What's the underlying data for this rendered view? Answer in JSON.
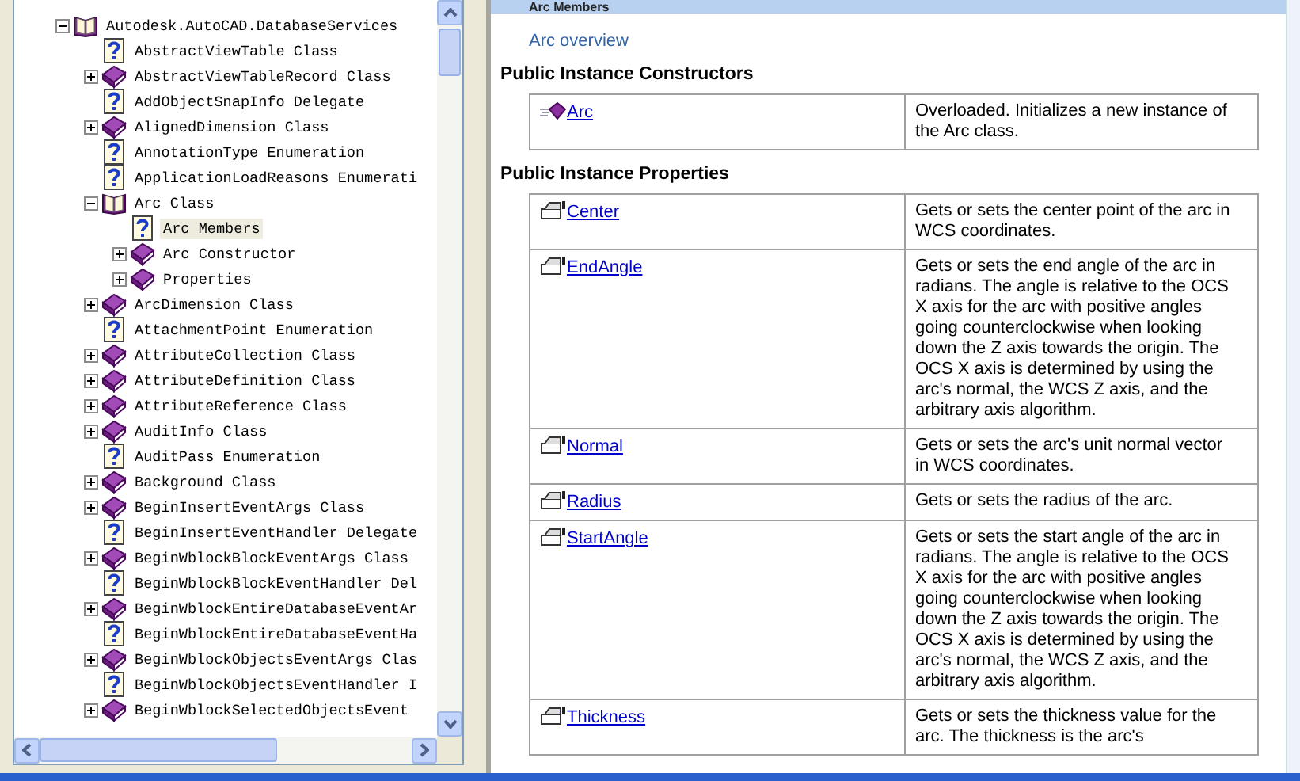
{
  "tree": [
    {
      "label": "Autodesk.AutoCAD.DatabaseServices",
      "kind": "namespace",
      "expanded": true,
      "selected": false,
      "children": [
        {
          "label": "AbstractViewTable Class",
          "kind": "page",
          "selected": false
        },
        {
          "label": "AbstractViewTableRecord Class",
          "kind": "class",
          "expanded": false,
          "selected": false
        },
        {
          "label": "AddObjectSnapInfo Delegate",
          "kind": "page",
          "selected": false
        },
        {
          "label": "AlignedDimension Class",
          "kind": "class",
          "expanded": false,
          "selected": false
        },
        {
          "label": "AnnotationType Enumeration",
          "kind": "page",
          "selected": false
        },
        {
          "label": "ApplicationLoadReasons Enumerati",
          "kind": "page",
          "selected": false
        },
        {
          "label": "Arc Class",
          "kind": "class",
          "expanded": true,
          "selected": false,
          "children": [
            {
              "label": "Arc Members",
              "kind": "page",
              "selected": true
            },
            {
              "label": "Arc Constructor",
              "kind": "class",
              "expanded": false,
              "selected": false
            },
            {
              "label": "Properties",
              "kind": "class",
              "expanded": false,
              "selected": false
            }
          ]
        },
        {
          "label": "ArcDimension Class",
          "kind": "class",
          "expanded": false,
          "selected": false
        },
        {
          "label": "AttachmentPoint Enumeration",
          "kind": "page",
          "selected": false
        },
        {
          "label": "AttributeCollection Class",
          "kind": "class",
          "expanded": false,
          "selected": false
        },
        {
          "label": "AttributeDefinition Class",
          "kind": "class",
          "expanded": false,
          "selected": false
        },
        {
          "label": "AttributeReference Class",
          "kind": "class",
          "expanded": false,
          "selected": false
        },
        {
          "label": "AuditInfo Class",
          "kind": "class",
          "expanded": false,
          "selected": false
        },
        {
          "label": "AuditPass Enumeration",
          "kind": "page",
          "selected": false
        },
        {
          "label": "Background Class",
          "kind": "class",
          "expanded": false,
          "selected": false
        },
        {
          "label": "BeginInsertEventArgs Class",
          "kind": "class",
          "expanded": false,
          "selected": false
        },
        {
          "label": "BeginInsertEventHandler Delegate",
          "kind": "page",
          "selected": false
        },
        {
          "label": "BeginWblockBlockEventArgs Class",
          "kind": "class",
          "expanded": false,
          "selected": false
        },
        {
          "label": "BeginWblockBlockEventHandler Del",
          "kind": "page",
          "selected": false
        },
        {
          "label": "BeginWblockEntireDatabaseEventAr",
          "kind": "class",
          "expanded": false,
          "selected": false
        },
        {
          "label": "BeginWblockEntireDatabaseEventHa",
          "kind": "page",
          "selected": false
        },
        {
          "label": "BeginWblockObjectsEventArgs Clas",
          "kind": "class",
          "expanded": false,
          "selected": false
        },
        {
          "label": "BeginWblockObjectsEventHandler I",
          "kind": "page",
          "selected": false
        },
        {
          "label": "BeginWblockSelectedObjectsEvent",
          "kind": "class",
          "expanded": false,
          "selected": false
        }
      ]
    }
  ],
  "page": {
    "title": "Arc Members",
    "overview_link": "Arc overview",
    "sections": [
      {
        "heading": "Public Instance Constructors",
        "rows": [
          {
            "kind": "method",
            "name": "Arc",
            "description": "Overloaded. Initializes a new instance of the Arc class."
          }
        ]
      },
      {
        "heading": "Public Instance Properties",
        "rows": [
          {
            "kind": "property",
            "name": "Center",
            "description": "Gets or sets the center point of the arc in WCS coordinates."
          },
          {
            "kind": "property",
            "name": "EndAngle",
            "description": "Gets or sets the end angle of the arc in radians. The angle is relative to the OCS X axis for the arc with positive angles going counterclockwise when looking down the Z axis towards the origin. The OCS X axis is determined by using the arc's normal, the WCS Z axis, and the arbitrary axis algorithm."
          },
          {
            "kind": "property",
            "name": "Normal",
            "description": "Gets or sets the arc's unit normal vector in WCS coordinates."
          },
          {
            "kind": "property",
            "name": "Radius",
            "description": "Gets or sets the radius of the arc."
          },
          {
            "kind": "property",
            "name": "StartAngle",
            "description": "Gets or sets the start angle of the arc in radians. The angle is relative to the OCS X axis for the arc with positive angles going counterclockwise when looking down the Z axis towards the origin. The OCS X axis is determined by using the arc's normal, the WCS Z axis, and the arbitrary axis algorithm."
          },
          {
            "kind": "property",
            "name": "Thickness",
            "description": "Gets or sets the thickness value for the arc. The thickness is the arc's"
          }
        ]
      }
    ]
  }
}
